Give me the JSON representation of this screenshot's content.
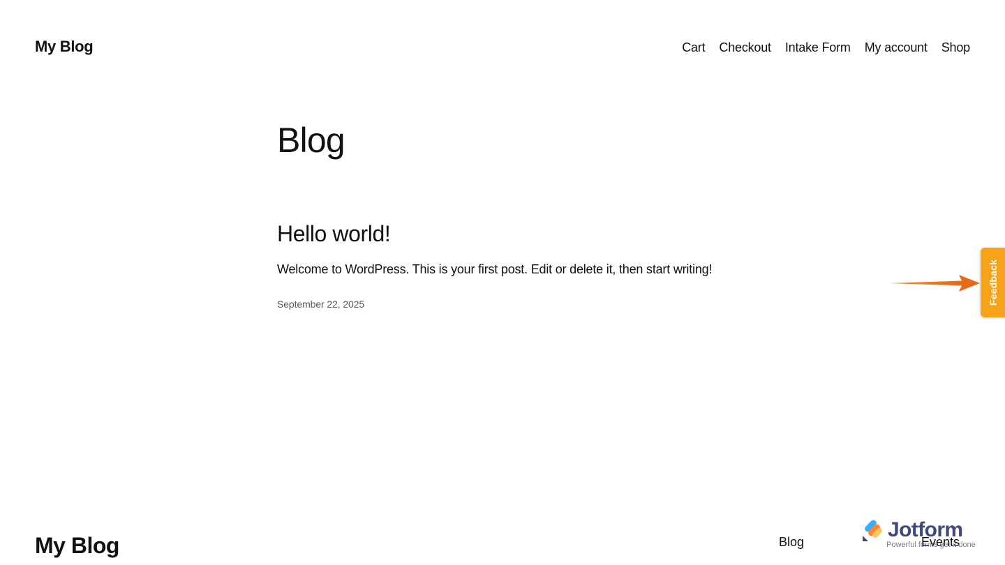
{
  "header": {
    "site_title": "My Blog",
    "nav": [
      {
        "label": "Cart"
      },
      {
        "label": "Checkout"
      },
      {
        "label": "Intake Form"
      },
      {
        "label": "My account"
      },
      {
        "label": "Shop"
      }
    ]
  },
  "main": {
    "heading": "Blog",
    "posts": [
      {
        "title": "Hello world!",
        "excerpt": "Welcome to WordPress. This is your first post. Edit or delete it, then start writing!",
        "date": "September 22, 2025"
      }
    ]
  },
  "feedback": {
    "label": "Feedback",
    "color": "#f7a21b",
    "arrow_icon": "arrow-right-icon",
    "arrow_color": "#e8701a"
  },
  "footer": {
    "site_title": "My Blog",
    "nav": [
      {
        "label": "Blog"
      },
      {
        "label": "Events"
      }
    ]
  },
  "jotform": {
    "name": "Jotform",
    "tagline": "Powerful forms get it done",
    "logo_icon": "jotform-logo-icon"
  }
}
